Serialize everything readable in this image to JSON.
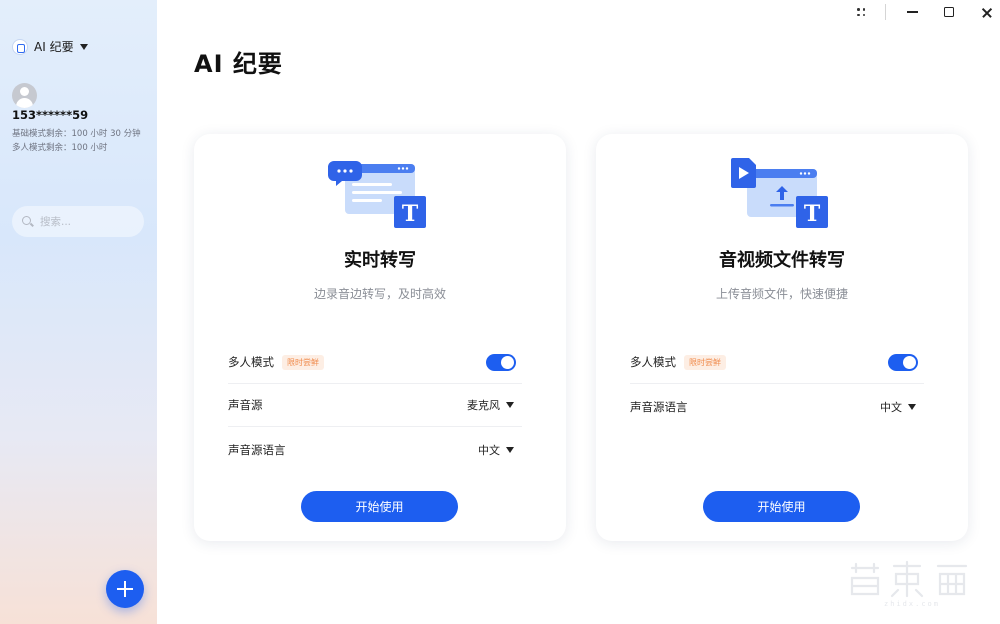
{
  "app": {
    "name": "AI 纪要"
  },
  "user": {
    "phone": "153******59",
    "basic_quota": "基础模式剩余：100 小时 30 分钟",
    "multi_quota": "多人模式剩余：100 小时"
  },
  "search": {
    "placeholder": "搜索..."
  },
  "page": {
    "title": "AI 纪要"
  },
  "cards": [
    {
      "title": "实时转写",
      "desc": "边录音边转写，及时高效",
      "multi_label": "多人模式",
      "badge": "限时尝鲜",
      "multi_on": true,
      "source_label": "声音源",
      "source_value": "麦克风",
      "lang_label": "声音源语言",
      "lang_value": "中文",
      "button": "开始使用"
    },
    {
      "title": "音视频文件转写",
      "desc": "上传音频文件，快速便捷",
      "multi_label": "多人模式",
      "badge": "限时尝鲜",
      "multi_on": true,
      "lang_label": "声音源语言",
      "lang_value": "中文",
      "button": "开始使用"
    }
  ],
  "colors": {
    "accent": "#1d5ef0",
    "badge_text": "#f08a4b",
    "badge_bg": "#fdeee4"
  },
  "icons": [
    "app-logo-icon",
    "chevron-down-icon",
    "search-icon",
    "plus-icon",
    "grid-icon",
    "minimize-icon",
    "maximize-icon",
    "close-icon"
  ]
}
